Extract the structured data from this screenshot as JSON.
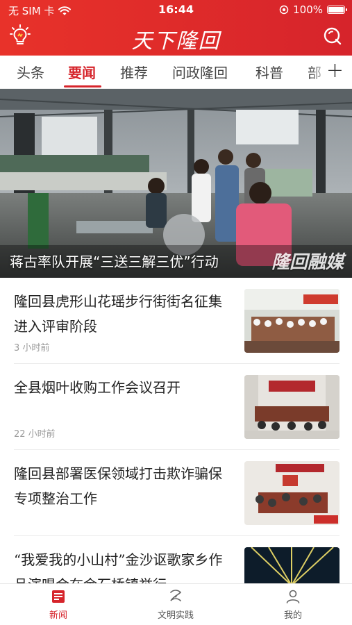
{
  "status_bar": {
    "carrier": "无 SIM 卡",
    "time": "16:44",
    "battery": "100%"
  },
  "header": {
    "logo_text": "天下隆回",
    "left_icon": "lightbulb-icon",
    "right_icon": "search-icon"
  },
  "tabs": [
    {
      "label": "头条",
      "active": false
    },
    {
      "label": "要闻",
      "active": true
    },
    {
      "label": "推荐",
      "active": false
    },
    {
      "label": "问政隆回",
      "active": false
    },
    {
      "label": "科普",
      "active": false
    },
    {
      "label": "部",
      "active": false
    }
  ],
  "tabs_more_label": "+",
  "banner": {
    "caption": "蒋古率队开展“三送三解三优”行动",
    "watermark": "隆回融媒"
  },
  "news": [
    {
      "title": "隆回县虎形山花瑶步行街街名征集进入评审阶段",
      "time": "3 小时前"
    },
    {
      "title": "全县烟叶收购工作会议召开",
      "time": "22 小时前"
    },
    {
      "title": "隆回县部署医保领域打击欺诈骗保专项整治工作",
      "time": ""
    },
    {
      "title": "“我爱我的小山村”金沙讴歌家乡作品演唱会在金石桥镇举行",
      "time": ""
    }
  ],
  "bottom_nav": [
    {
      "label": "新闻",
      "icon": "news-icon",
      "active": true
    },
    {
      "label": "文明实践",
      "icon": "civilization-icon",
      "active": false
    },
    {
      "label": "我的",
      "icon": "profile-icon",
      "active": false
    }
  ],
  "colors": {
    "brand_red": "#d6242b",
    "text_dark": "#222222",
    "text_muted": "#999999"
  }
}
